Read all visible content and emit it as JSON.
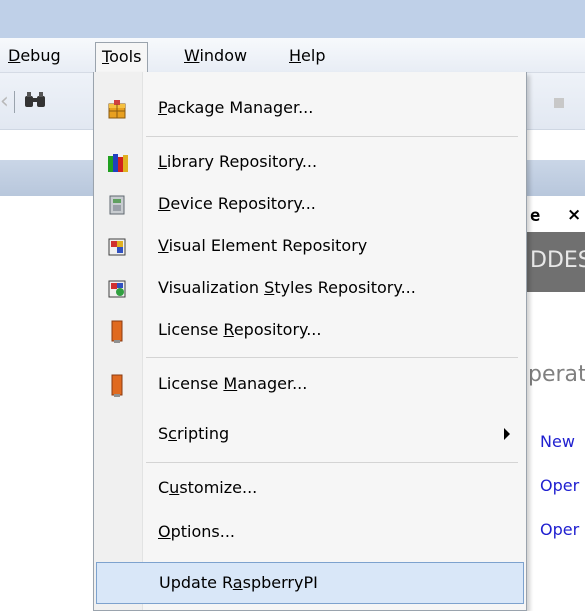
{
  "menubar": {
    "items": [
      {
        "pre": "",
        "mn": "D",
        "post": "ebug"
      },
      {
        "pre": "",
        "mn": "T",
        "post": "ools"
      },
      {
        "pre": "",
        "mn": "W",
        "post": "indow"
      },
      {
        "pre": "",
        "mn": "H",
        "post": "elp"
      }
    ]
  },
  "background": {
    "tab_text": "e",
    "tab_close": "×",
    "banner_text": "DDES",
    "section_text": "perat",
    "links": [
      "New",
      "Oper",
      "Oper"
    ]
  },
  "tools_menu": {
    "items": [
      {
        "pre": "",
        "mn": "P",
        "post": "ackage Manager...",
        "icon": "package-manager-icon"
      },
      {
        "pre": "",
        "mn": "L",
        "post": "ibrary Repository...",
        "icon": "library-repository-icon"
      },
      {
        "pre": "",
        "mn": "D",
        "post": "evice Repository...",
        "icon": "device-repository-icon"
      },
      {
        "pre": "",
        "mn": "V",
        "post": "isual Element Repository",
        "icon": "visual-element-icon"
      },
      {
        "pre": "Visualization ",
        "mn": "S",
        "post": "tyles Repository...",
        "icon": "visualization-styles-icon"
      },
      {
        "pre": "License ",
        "mn": "R",
        "post": "epository...",
        "icon": "license-repository-icon"
      },
      {
        "pre": "License ",
        "mn": "M",
        "post": "anager...",
        "icon": "license-manager-icon"
      },
      {
        "pre": "S",
        "mn": "c",
        "post": "ripting",
        "icon": ""
      },
      {
        "pre": "C",
        "mn": "u",
        "post": "stomize...",
        "icon": ""
      },
      {
        "pre": "",
        "mn": "O",
        "post": "ptions...",
        "icon": ""
      },
      {
        "pre": "Update R",
        "mn": "a",
        "post": "spberryPI",
        "icon": ""
      }
    ]
  }
}
